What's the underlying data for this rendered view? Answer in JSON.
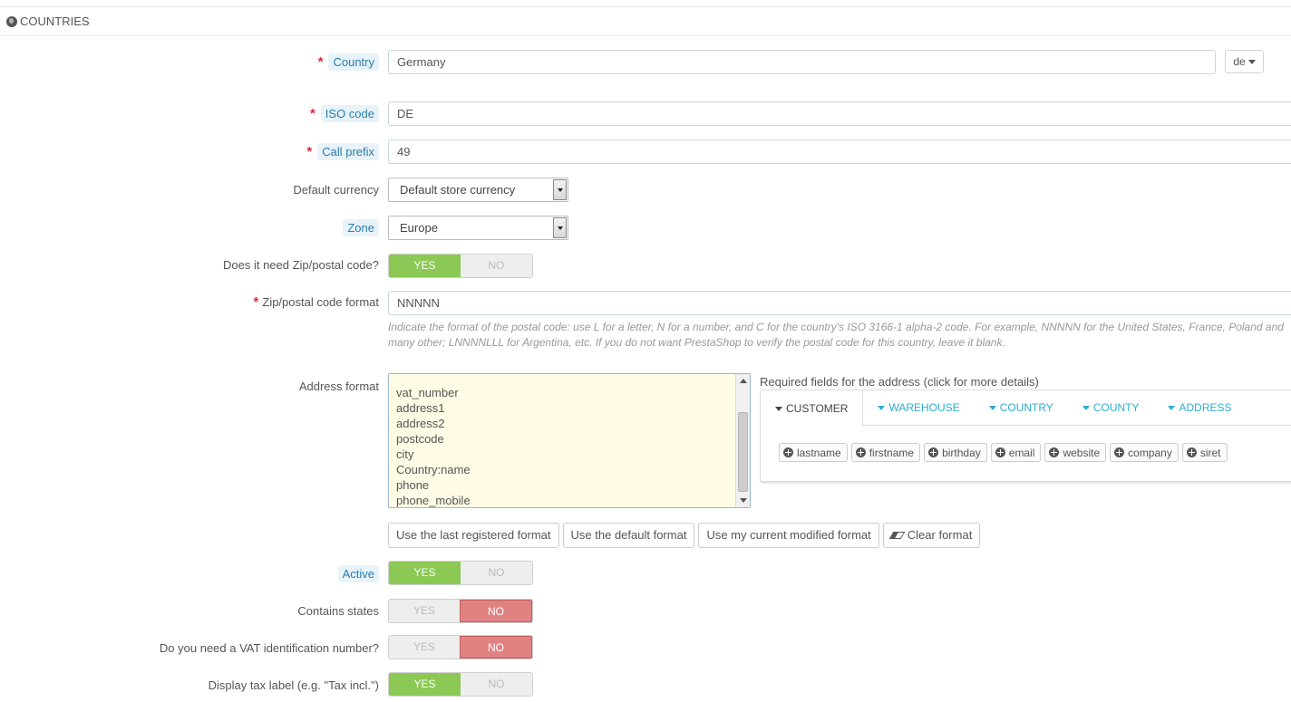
{
  "panel": {
    "title": "COUNTRIES",
    "icon": "globe-icon"
  },
  "fields": {
    "country": {
      "label": "Country",
      "value": "Germany",
      "lang": "de"
    },
    "iso_code": {
      "label": "ISO code",
      "value": "DE"
    },
    "call_prefix": {
      "label": "Call prefix",
      "value": "49"
    },
    "default_currency": {
      "label": "Default currency",
      "value": "Default store currency"
    },
    "zone": {
      "label": "Zone",
      "value": "Europe"
    },
    "need_zip": {
      "label": "Does it need Zip/postal code?",
      "yes": "YES",
      "no": "NO",
      "selected": "yes"
    },
    "zip_format": {
      "label": "Zip/postal code format",
      "value": "NNNNN",
      "help": "Indicate the format of the postal code: use L for a letter, N for a number, and C for the country's ISO 3166-1 alpha-2 code. For example, NNNNN for the United States, France, Poland and many other; LNNNNLLL for Argentina, etc. If you do not want PrestaShop to verify the postal code for this country, leave it blank."
    },
    "address_format": {
      "label": "Address format",
      "lines": [
        "vat_number",
        "address1",
        "address2",
        "postcode",
        "city",
        "Country:name",
        "phone",
        "phone_mobile"
      ]
    },
    "active": {
      "label": "Active",
      "yes": "YES",
      "no": "NO",
      "selected": "yes"
    },
    "contains_states": {
      "label": "Contains states",
      "yes": "YES",
      "no": "NO",
      "selected": "no"
    },
    "need_vat": {
      "label": "Do you need a VAT identification number?",
      "yes": "YES",
      "no": "NO",
      "selected": "no"
    },
    "display_tax": {
      "label": "Display tax label (e.g. \"Tax incl.\")",
      "yes": "YES",
      "no": "NO",
      "selected": "yes"
    }
  },
  "required_fields": {
    "title": "Required fields for the address (click for more details)",
    "tabs": [
      "CUSTOMER",
      "WAREHOUSE",
      "COUNTRY",
      "COUNTY",
      "ADDRESS"
    ],
    "active_tab": "CUSTOMER",
    "chips": [
      "lastname",
      "firstname",
      "birthday",
      "email",
      "website",
      "company",
      "siret"
    ]
  },
  "format_buttons": {
    "last_registered": "Use the last registered format",
    "default": "Use the default format",
    "current_modified": "Use my current modified format",
    "clear": "Clear format"
  },
  "colors": {
    "yes_active": "#8bc954",
    "no_active": "#e08282",
    "accent": "#2eacce"
  }
}
